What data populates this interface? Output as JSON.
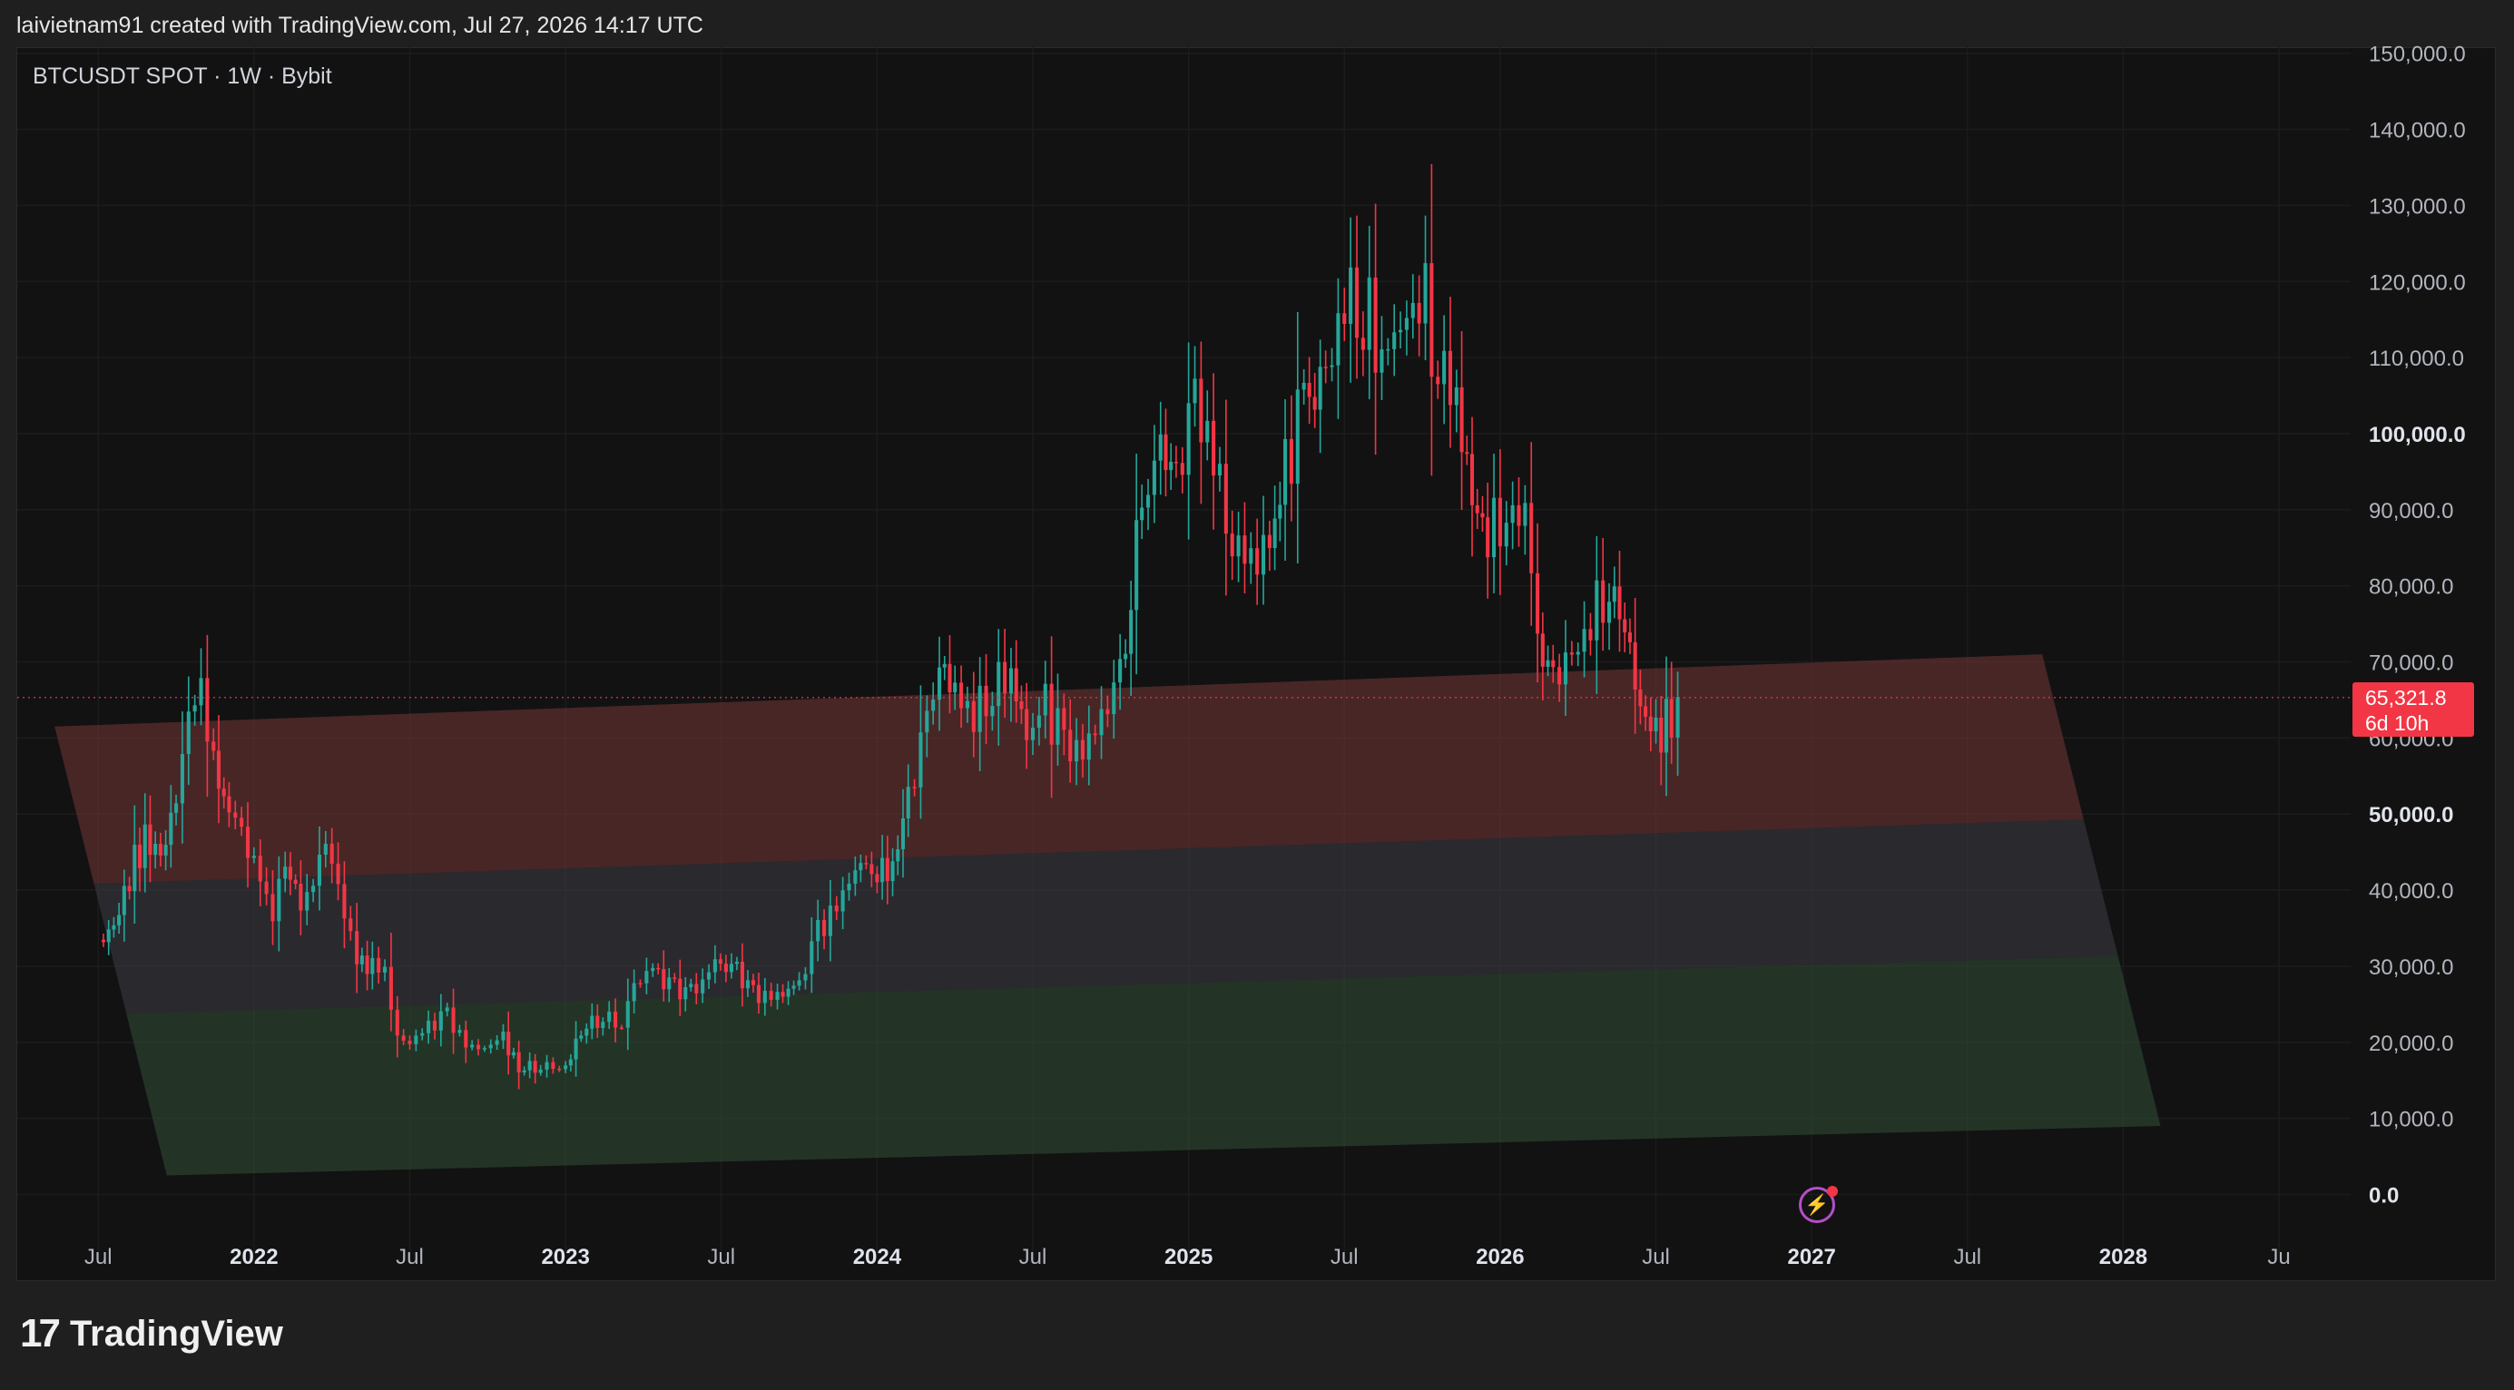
{
  "header": {
    "attribution": "laivietnam91 created with TradingView.com, Jul 27, 2026 14:17 UTC"
  },
  "symbol_info": "BTCUSDT SPOT · 1W · Bybit",
  "brand": {
    "mark": "17",
    "name": "TradingView"
  },
  "last_price": {
    "price": "65,321.8",
    "countdown": "6d 10h"
  },
  "colors": {
    "up": "#26a69a",
    "down": "#f23645",
    "channel_upper": "#6b3434",
    "channel_middle": "#3a3a40",
    "channel_lower": "#2e4a33",
    "price_line": "#f23645"
  },
  "icons": {
    "alert": "flash-alert-icon"
  },
  "chart_data": {
    "type": "candlestick",
    "title": "",
    "xlabel": "",
    "ylabel": "",
    "x_ticks": [
      {
        "t": 2021.5,
        "label": "Jul",
        "bold": false
      },
      {
        "t": 2022.0,
        "label": "2022",
        "bold": true
      },
      {
        "t": 2022.5,
        "label": "Jul",
        "bold": false
      },
      {
        "t": 2023.0,
        "label": "2023",
        "bold": true
      },
      {
        "t": 2023.5,
        "label": "Jul",
        "bold": false
      },
      {
        "t": 2024.0,
        "label": "2024",
        "bold": true
      },
      {
        "t": 2024.5,
        "label": "Jul",
        "bold": false
      },
      {
        "t": 2025.0,
        "label": "2025",
        "bold": true
      },
      {
        "t": 2025.5,
        "label": "Jul",
        "bold": false
      },
      {
        "t": 2026.0,
        "label": "2026",
        "bold": true
      },
      {
        "t": 2026.5,
        "label": "Jul",
        "bold": false
      },
      {
        "t": 2027.0,
        "label": "2027",
        "bold": true
      },
      {
        "t": 2027.5,
        "label": "Jul",
        "bold": false
      },
      {
        "t": 2028.0,
        "label": "2028",
        "bold": true
      },
      {
        "t": 2028.5,
        "label": "Ju",
        "bold": false
      }
    ],
    "y_ticks": [
      {
        "v": 0,
        "label": "0.0",
        "bold": true
      },
      {
        "v": 10000,
        "label": "10,000.0",
        "bold": false
      },
      {
        "v": 20000,
        "label": "20,000.0",
        "bold": false
      },
      {
        "v": 30000,
        "label": "30,000.0",
        "bold": false
      },
      {
        "v": 40000,
        "label": "40,000.0",
        "bold": false
      },
      {
        "v": 50000,
        "label": "50,000.0",
        "bold": true
      },
      {
        "v": 60000,
        "label": "60,000.0",
        "bold": false
      },
      {
        "v": 70000,
        "label": "70,000.0",
        "bold": false
      },
      {
        "v": 80000,
        "label": "80,000.0",
        "bold": false
      },
      {
        "v": 90000,
        "label": "90,000.0",
        "bold": false
      },
      {
        "v": 100000,
        "label": "100,000.0",
        "bold": true
      },
      {
        "v": 110000,
        "label": "110,000.0",
        "bold": false
      },
      {
        "v": 120000,
        "label": "120,000.0",
        "bold": false
      },
      {
        "v": 130000,
        "label": "130,000.0",
        "bold": false
      },
      {
        "v": 140000,
        "label": "140,000.0",
        "bold": false
      },
      {
        "v": 150000,
        "label": "150,000.0",
        "bold": false
      }
    ],
    "x_range": [
      2021.24,
      2028.73
    ],
    "y_range": [
      -4000,
      150800
    ],
    "last_price": 65321.8,
    "closes": [
      [
        2021.5,
        33000
      ],
      [
        2021.55,
        35000
      ],
      [
        2021.6,
        42000
      ],
      [
        2021.65,
        47000
      ],
      [
        2021.7,
        44000
      ],
      [
        2021.75,
        52000
      ],
      [
        2021.79,
        62000
      ],
      [
        2021.83,
        65000
      ],
      [
        2021.87,
        57000
      ],
      [
        2021.92,
        49000
      ],
      [
        2021.96,
        47000
      ],
      [
        2022.02,
        42000
      ],
      [
        2022.06,
        37000
      ],
      [
        2022.1,
        43000
      ],
      [
        2022.15,
        39000
      ],
      [
        2022.19,
        42000
      ],
      [
        2022.23,
        46000
      ],
      [
        2022.27,
        40000
      ],
      [
        2022.33,
        31000
      ],
      [
        2022.38,
        29500
      ],
      [
        2022.42,
        29000
      ],
      [
        2022.46,
        21000
      ],
      [
        2022.5,
        20000
      ],
      [
        2022.56,
        22000
      ],
      [
        2022.62,
        23500
      ],
      [
        2022.68,
        19500
      ],
      [
        2022.74,
        19300
      ],
      [
        2022.8,
        20500
      ],
      [
        2022.85,
        16500
      ],
      [
        2022.92,
        16900
      ],
      [
        2023.0,
        16600
      ],
      [
        2023.05,
        21500
      ],
      [
        2023.12,
        23500
      ],
      [
        2023.18,
        22500
      ],
      [
        2023.22,
        27500
      ],
      [
        2023.28,
        29500
      ],
      [
        2023.35,
        27000
      ],
      [
        2023.42,
        26800
      ],
      [
        2023.48,
        30500
      ],
      [
        2023.55,
        29300
      ],
      [
        2023.62,
        26000
      ],
      [
        2023.68,
        26200
      ],
      [
        2023.75,
        27500
      ],
      [
        2023.81,
        34500
      ],
      [
        2023.87,
        37500
      ],
      [
        2023.93,
        43500
      ],
      [
        2024.0,
        42500
      ],
      [
        2024.05,
        43000
      ],
      [
        2024.1,
        52000
      ],
      [
        2024.16,
        62000
      ],
      [
        2024.2,
        70000
      ],
      [
        2024.25,
        66000
      ],
      [
        2024.31,
        63000
      ],
      [
        2024.37,
        67000
      ],
      [
        2024.43,
        68500
      ],
      [
        2024.48,
        60000
      ],
      [
        2024.54,
        64000
      ],
      [
        2024.6,
        59000
      ],
      [
        2024.66,
        58000
      ],
      [
        2024.72,
        63000
      ],
      [
        2024.78,
        67000
      ],
      [
        2024.85,
        90000
      ],
      [
        2024.91,
        98000
      ],
      [
        2024.96,
        94000
      ],
      [
        2025.02,
        104000
      ],
      [
        2025.08,
        97000
      ],
      [
        2025.14,
        86000
      ],
      [
        2025.2,
        83000
      ],
      [
        2025.26,
        85000
      ],
      [
        2025.31,
        95000
      ],
      [
        2025.37,
        104000
      ],
      [
        2025.44,
        107000
      ],
      [
        2025.5,
        118000
      ],
      [
        2025.56,
        117000
      ],
      [
        2025.62,
        111000
      ],
      [
        2025.68,
        113000
      ],
      [
        2025.74,
        120000
      ],
      [
        2025.8,
        110000
      ],
      [
        2025.86,
        104000
      ],
      [
        2025.91,
        91000
      ],
      [
        2025.96,
        87000
      ],
      [
        2026.02,
        90000
      ],
      [
        2026.08,
        88000
      ],
      [
        2026.12,
        72000
      ],
      [
        2026.17,
        68000
      ],
      [
        2026.23,
        70000
      ],
      [
        2026.29,
        76000
      ],
      [
        2026.35,
        80000
      ],
      [
        2026.4,
        75000
      ],
      [
        2026.45,
        64000
      ],
      [
        2026.5,
        60000
      ],
      [
        2026.55,
        63000
      ],
      [
        2026.57,
        65321.8
      ]
    ],
    "channel": {
      "bottom_line": [
        [
          2021.36,
          61500
        ],
        [
          2027.74,
          71000
        ]
      ],
      "top_line": [
        [
          2021.72,
          2500
        ],
        [
          2028.12,
          9000
        ]
      ],
      "bands": [
        {
          "from": 0.0,
          "to": 0.35,
          "color_key": "channel_upper"
        },
        {
          "from": 0.35,
          "to": 0.64,
          "color_key": "channel_middle"
        },
        {
          "from": 0.64,
          "to": 1.0,
          "color_key": "channel_lower"
        }
      ]
    }
  }
}
